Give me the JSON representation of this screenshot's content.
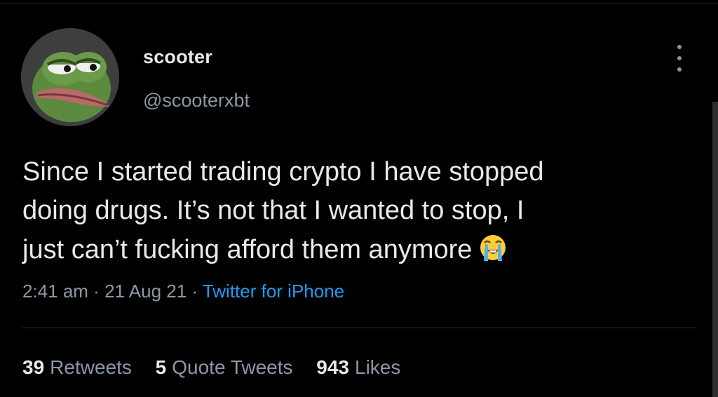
{
  "user": {
    "display_name": "scooter",
    "handle": "@scooterxbt",
    "avatar_icon": "pepe-frog-avatar"
  },
  "tweet": {
    "lines": [
      "Since I started trading crypto I have stopped",
      "doing drugs. It’s not that I wanted to stop, I",
      "just can’t fucking afford them anymore"
    ],
    "emoji": "loudly-crying-face-emoji"
  },
  "meta": {
    "time": "2:41 am",
    "sep1": " · ",
    "date": "21 Aug 21",
    "sep2": " · ",
    "source": "Twitter for iPhone"
  },
  "stats": {
    "retweets_count": "39",
    "retweets_label": "Retweets",
    "quotes_count": "5",
    "quotes_label": "Quote Tweets",
    "likes_count": "943",
    "likes_label": "Likes"
  },
  "colors": {
    "background": "#000000",
    "primary_text": "#e7e9ea",
    "secondary_text": "#8b98a5",
    "link": "#1d9bf0",
    "divider": "#2f3336"
  }
}
